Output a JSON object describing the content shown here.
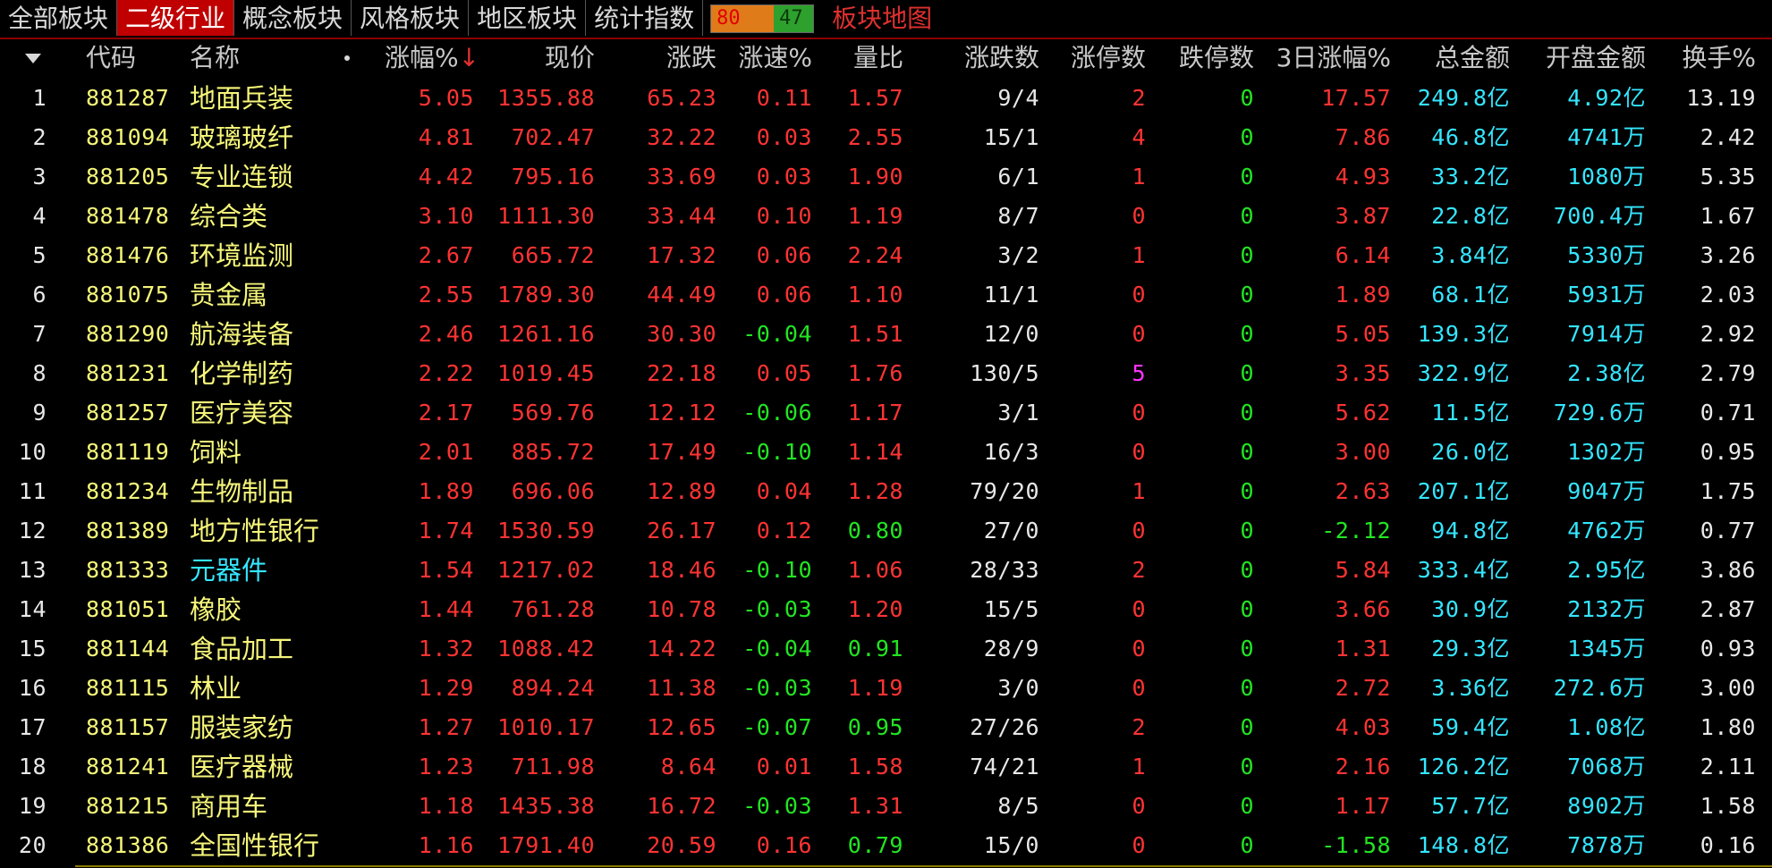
{
  "tabs": [
    "全部板块",
    "二级行业",
    "概念板块",
    "风格板块",
    "地区板块",
    "统计指数"
  ],
  "active_tab_index": 1,
  "updown": {
    "up": "80",
    "down": "47"
  },
  "map_link": "板块地图",
  "columns": {
    "code": "代码",
    "name": "名称",
    "pct": "涨幅%",
    "pct_arrow": "↓",
    "price": "现价",
    "change": "涨跌",
    "speed": "涨速%",
    "vol_ratio": "量比",
    "updown_count": "涨跌数",
    "limit_up": "涨停数",
    "limit_down": "跌停数",
    "pct3d": "3日涨幅%",
    "total_amt": "总金额",
    "open_amt": "开盘金额",
    "turnover": "换手%"
  },
  "colors": {
    "up": "#ff3333",
    "down": "#22e522",
    "flat": "#e8e8e8",
    "amount": "#34e6ff",
    "code": "#f6f67a",
    "limit_up_high": "#ff33ff",
    "active_tab": "#c00000"
  },
  "rows": [
    {
      "idx": "1",
      "code": "881287",
      "name": "地面兵装",
      "pct": "5.05",
      "price": "1355.88",
      "change": "65.23",
      "speed": "0.11",
      "vol_ratio": "1.57",
      "updown_count": "9/4",
      "limit_up": "2",
      "limit_down": "0",
      "pct3d": "17.57",
      "total_amt": "249.8亿",
      "open_amt": "4.92亿",
      "turnover": "13.19"
    },
    {
      "idx": "2",
      "code": "881094",
      "name": "玻璃玻纤",
      "pct": "4.81",
      "price": "702.47",
      "change": "32.22",
      "speed": "0.03",
      "vol_ratio": "2.55",
      "updown_count": "15/1",
      "limit_up": "4",
      "limit_down": "0",
      "pct3d": "7.86",
      "total_amt": "46.8亿",
      "open_amt": "4741万",
      "turnover": "2.42"
    },
    {
      "idx": "3",
      "code": "881205",
      "name": "专业连锁",
      "pct": "4.42",
      "price": "795.16",
      "change": "33.69",
      "speed": "0.03",
      "vol_ratio": "1.90",
      "updown_count": "6/1",
      "limit_up": "1",
      "limit_down": "0",
      "pct3d": "4.93",
      "total_amt": "33.2亿",
      "open_amt": "1080万",
      "turnover": "5.35"
    },
    {
      "idx": "4",
      "code": "881478",
      "name": "综合类",
      "pct": "3.10",
      "price": "1111.30",
      "change": "33.44",
      "speed": "0.10",
      "vol_ratio": "1.19",
      "updown_count": "8/7",
      "limit_up": "0",
      "limit_down": "0",
      "pct3d": "3.87",
      "total_amt": "22.8亿",
      "open_amt": "700.4万",
      "turnover": "1.67"
    },
    {
      "idx": "5",
      "code": "881476",
      "name": "环境监测",
      "pct": "2.67",
      "price": "665.72",
      "change": "17.32",
      "speed": "0.06",
      "vol_ratio": "2.24",
      "updown_count": "3/2",
      "limit_up": "1",
      "limit_down": "0",
      "pct3d": "6.14",
      "total_amt": "3.84亿",
      "open_amt": "5330万",
      "turnover": "3.26"
    },
    {
      "idx": "6",
      "code": "881075",
      "name": "贵金属",
      "pct": "2.55",
      "price": "1789.30",
      "change": "44.49",
      "speed": "0.06",
      "vol_ratio": "1.10",
      "updown_count": "11/1",
      "limit_up": "0",
      "limit_down": "0",
      "pct3d": "1.89",
      "total_amt": "68.1亿",
      "open_amt": "5931万",
      "turnover": "2.03"
    },
    {
      "idx": "7",
      "code": "881290",
      "name": "航海装备",
      "pct": "2.46",
      "price": "1261.16",
      "change": "30.30",
      "speed": "-0.04",
      "vol_ratio": "1.51",
      "updown_count": "12/0",
      "limit_up": "0",
      "limit_down": "0",
      "pct3d": "5.05",
      "total_amt": "139.3亿",
      "open_amt": "7914万",
      "turnover": "2.92"
    },
    {
      "idx": "8",
      "code": "881231",
      "name": "化学制药",
      "pct": "2.22",
      "price": "1019.45",
      "change": "22.18",
      "speed": "0.05",
      "vol_ratio": "1.76",
      "updown_count": "130/5",
      "limit_up": "5",
      "limit_down": "0",
      "pct3d": "3.35",
      "total_amt": "322.9亿",
      "open_amt": "2.38亿",
      "turnover": "2.79"
    },
    {
      "idx": "9",
      "code": "881257",
      "name": "医疗美容",
      "pct": "2.17",
      "price": "569.76",
      "change": "12.12",
      "speed": "-0.06",
      "vol_ratio": "1.17",
      "updown_count": "3/1",
      "limit_up": "0",
      "limit_down": "0",
      "pct3d": "5.62",
      "total_amt": "11.5亿",
      "open_amt": "729.6万",
      "turnover": "0.71"
    },
    {
      "idx": "10",
      "code": "881119",
      "name": "饲料",
      "pct": "2.01",
      "price": "885.72",
      "change": "17.49",
      "speed": "-0.10",
      "vol_ratio": "1.14",
      "updown_count": "16/3",
      "limit_up": "0",
      "limit_down": "0",
      "pct3d": "3.00",
      "total_amt": "26.0亿",
      "open_amt": "1302万",
      "turnover": "0.95"
    },
    {
      "idx": "11",
      "code": "881234",
      "name": "生物制品",
      "pct": "1.89",
      "price": "696.06",
      "change": "12.89",
      "speed": "0.04",
      "vol_ratio": "1.28",
      "updown_count": "79/20",
      "limit_up": "1",
      "limit_down": "0",
      "pct3d": "2.63",
      "total_amt": "207.1亿",
      "open_amt": "9047万",
      "turnover": "1.75"
    },
    {
      "idx": "12",
      "code": "881389",
      "name": "地方性银行",
      "pct": "1.74",
      "price": "1530.59",
      "change": "26.17",
      "speed": "0.12",
      "vol_ratio": "0.80",
      "updown_count": "27/0",
      "limit_up": "0",
      "limit_down": "0",
      "pct3d": "-2.12",
      "total_amt": "94.8亿",
      "open_amt": "4762万",
      "turnover": "0.77"
    },
    {
      "idx": "13",
      "code": "881333",
      "name": "元器件",
      "pct": "1.54",
      "price": "1217.02",
      "change": "18.46",
      "speed": "-0.10",
      "vol_ratio": "1.06",
      "updown_count": "28/33",
      "limit_up": "2",
      "limit_down": "0",
      "pct3d": "5.84",
      "total_amt": "333.4亿",
      "open_amt": "2.95亿",
      "turnover": "3.86"
    },
    {
      "idx": "14",
      "code": "881051",
      "name": "橡胶",
      "pct": "1.44",
      "price": "761.28",
      "change": "10.78",
      "speed": "-0.03",
      "vol_ratio": "1.20",
      "updown_count": "15/5",
      "limit_up": "0",
      "limit_down": "0",
      "pct3d": "3.66",
      "total_amt": "30.9亿",
      "open_amt": "2132万",
      "turnover": "2.87"
    },
    {
      "idx": "15",
      "code": "881144",
      "name": "食品加工",
      "pct": "1.32",
      "price": "1088.42",
      "change": "14.22",
      "speed": "-0.04",
      "vol_ratio": "0.91",
      "updown_count": "28/9",
      "limit_up": "0",
      "limit_down": "0",
      "pct3d": "1.31",
      "total_amt": "29.3亿",
      "open_amt": "1345万",
      "turnover": "0.93"
    },
    {
      "idx": "16",
      "code": "881115",
      "name": "林业",
      "pct": "1.29",
      "price": "894.24",
      "change": "11.38",
      "speed": "-0.03",
      "vol_ratio": "1.19",
      "updown_count": "3/0",
      "limit_up": "0",
      "limit_down": "0",
      "pct3d": "2.72",
      "total_amt": "3.36亿",
      "open_amt": "272.6万",
      "turnover": "3.00"
    },
    {
      "idx": "17",
      "code": "881157",
      "name": "服装家纺",
      "pct": "1.27",
      "price": "1010.17",
      "change": "12.65",
      "speed": "-0.07",
      "vol_ratio": "0.95",
      "updown_count": "27/26",
      "limit_up": "2",
      "limit_down": "0",
      "pct3d": "4.03",
      "total_amt": "59.4亿",
      "open_amt": "1.08亿",
      "turnover": "1.80"
    },
    {
      "idx": "18",
      "code": "881241",
      "name": "医疗器械",
      "pct": "1.23",
      "price": "711.98",
      "change": "8.64",
      "speed": "0.01",
      "vol_ratio": "1.58",
      "updown_count": "74/21",
      "limit_up": "1",
      "limit_down": "0",
      "pct3d": "2.16",
      "total_amt": "126.2亿",
      "open_amt": "7068万",
      "turnover": "2.11"
    },
    {
      "idx": "19",
      "code": "881215",
      "name": "商用车",
      "pct": "1.18",
      "price": "1435.38",
      "change": "16.72",
      "speed": "-0.03",
      "vol_ratio": "1.31",
      "updown_count": "8/5",
      "limit_up": "0",
      "limit_down": "0",
      "pct3d": "1.17",
      "total_amt": "57.7亿",
      "open_amt": "8902万",
      "turnover": "1.58"
    },
    {
      "idx": "20",
      "code": "881386",
      "name": "全国性银行",
      "pct": "1.16",
      "price": "1791.40",
      "change": "20.59",
      "speed": "0.16",
      "vol_ratio": "0.79",
      "updown_count": "15/0",
      "limit_up": "0",
      "limit_down": "0",
      "pct3d": "-1.58",
      "total_amt": "148.8亿",
      "open_amt": "7878万",
      "turnover": "0.16"
    }
  ]
}
